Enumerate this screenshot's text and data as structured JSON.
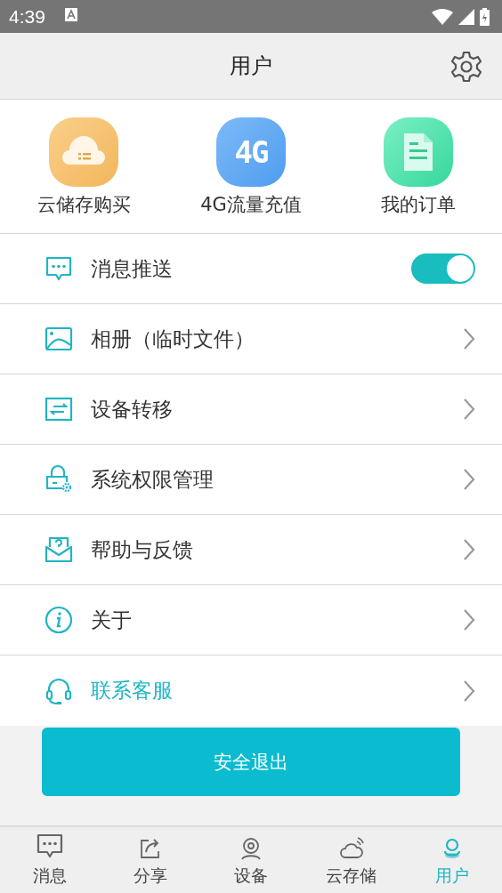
{
  "status_bar": {
    "time": "4:39"
  },
  "header": {
    "title": "用户"
  },
  "shortcuts": [
    {
      "label": "云储存购买"
    },
    {
      "label": "4G流量充值",
      "icon_text": "4G"
    },
    {
      "label": "我的订单"
    }
  ],
  "menu": [
    {
      "kind": "toggle",
      "label": "消息推送",
      "on": true,
      "highlighted": false
    },
    {
      "kind": "link",
      "label": "相册（临时文件）",
      "highlighted": false
    },
    {
      "kind": "link",
      "label": "设备转移",
      "highlighted": false
    },
    {
      "kind": "link",
      "label": "系统权限管理",
      "highlighted": false
    },
    {
      "kind": "link",
      "label": "帮助与反馈",
      "highlighted": false
    },
    {
      "kind": "link",
      "label": "关于",
      "highlighted": false
    },
    {
      "kind": "link",
      "label": "联系客服",
      "highlighted": true
    }
  ],
  "logout_button": "安全退出",
  "tabs": [
    {
      "label": "消息",
      "selected": false
    },
    {
      "label": "分享",
      "selected": false
    },
    {
      "label": "设备",
      "selected": false
    },
    {
      "label": "云存储",
      "selected": false
    },
    {
      "label": "用户",
      "selected": true
    }
  ]
}
